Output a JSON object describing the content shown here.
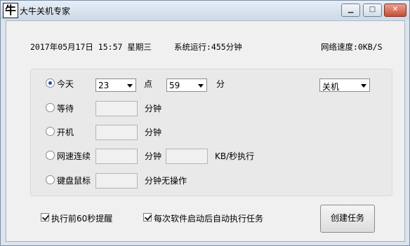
{
  "window": {
    "title": "大牛关机专家",
    "icon_glyph": "牛",
    "minimize_glyph": "▁",
    "maximize_glyph": "□",
    "close_glyph": "✕"
  },
  "status": {
    "datetime": "2017年05月17日  15:57  星期三",
    "uptime": "系统运行:455分钟",
    "speed": "网络速度:0KB/S"
  },
  "options": {
    "today": {
      "label": "今天",
      "hour": "23",
      "hour_unit": "点",
      "minute": "59",
      "minute_unit": "分"
    },
    "action": "关机",
    "wait": {
      "label": "等待",
      "unit": "分钟"
    },
    "boot": {
      "label": "开机",
      "unit": "分钟"
    },
    "netspeed": {
      "label": "网速连续",
      "unit": "分钟",
      "speed_unit": "KB/秒执行"
    },
    "idle": {
      "label": "键盘鼠标",
      "unit": "分钟无操作"
    }
  },
  "checks": {
    "remind": "执行前60秒提醒",
    "autorun": "每次软件启动后自动执行任务"
  },
  "create_button": "创建任务"
}
